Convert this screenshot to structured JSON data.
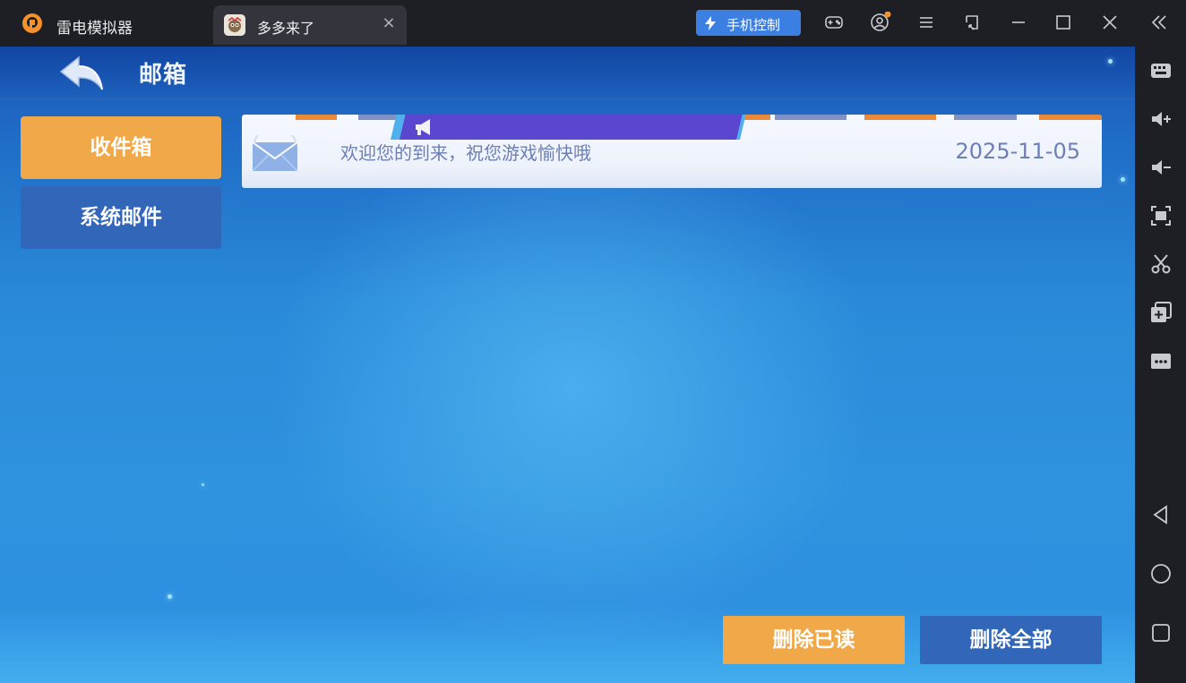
{
  "titlebar": {
    "app_name": "雷电模拟器",
    "tab_label": "多多来了",
    "tab_close": "×",
    "phone_control_label": "手机控制"
  },
  "game": {
    "page_title": "邮箱",
    "tabs": [
      {
        "label": "收件箱",
        "active": true
      },
      {
        "label": "系统邮件",
        "active": false
      }
    ],
    "mails": [
      {
        "subject": "欢迎您的到来，祝您游戏愉快哦",
        "date": "2025-11-05"
      }
    ],
    "actions": {
      "delete_read": "删除已读",
      "delete_all": "删除全部"
    }
  },
  "colors": {
    "accent_orange": "#f0a848",
    "button_blue": "#3266b8",
    "phone_control_blue": "#3b7fe3",
    "banner_purple": "#5b46cf",
    "mail_text": "#6c7fb6",
    "notification_dot": "#f5922b"
  },
  "icons": {
    "titlebar": [
      "app-logo-icon",
      "gamepad-icon",
      "user-icon",
      "menu-icon",
      "resize-icon",
      "minimize-icon",
      "maximize-icon",
      "close-icon",
      "collapse-icon"
    ],
    "sidebar": [
      "keyboard-icon",
      "volume-up-icon",
      "volume-down-icon",
      "screenshot-icon",
      "scissors-icon",
      "add-window-icon",
      "more-icon",
      "back-nav-icon",
      "home-nav-icon",
      "recents-nav-icon"
    ],
    "game": [
      "back-arrow-icon",
      "envelope-icon",
      "megaphone-icon"
    ]
  }
}
